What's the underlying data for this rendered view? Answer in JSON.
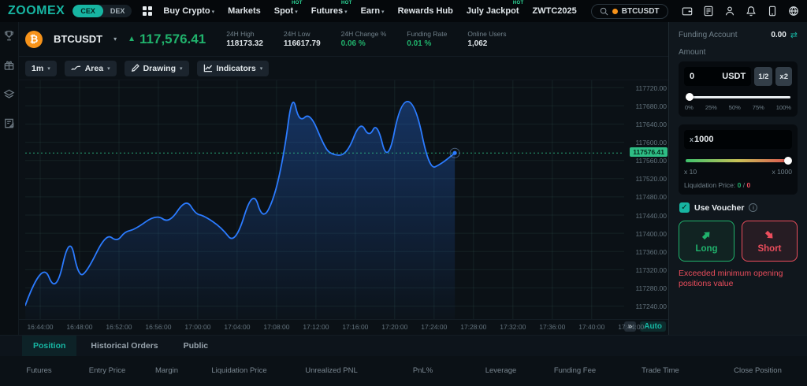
{
  "colors": {
    "accent": "#17b5a2",
    "green": "#20b26c",
    "red": "#eb4d5c",
    "blue": "#2b7bff",
    "orange": "#f7931a",
    "price_badge": "#2ebd85"
  },
  "nav": {
    "logo": "ZOOMEX",
    "cex": "CEX",
    "dex": "DEX",
    "hot_label": "HOT",
    "items": [
      {
        "label": "Buy Crypto"
      },
      {
        "label": "Markets"
      },
      {
        "label": "Spot"
      },
      {
        "label": "Futures"
      },
      {
        "label": "Earn"
      },
      {
        "label": "Rewards Hub"
      },
      {
        "label": "July Jackpot"
      },
      {
        "label": "ZWTC2025"
      }
    ],
    "search": {
      "value": "BTCUSDT"
    }
  },
  "ticker": {
    "symbol": "BTCUSDT",
    "up_arrow": "▲",
    "price": "117,576.41",
    "stats": [
      {
        "label": "24H High",
        "value": "118173.32"
      },
      {
        "label": "24H Low",
        "value": "116617.79"
      },
      {
        "label": "24H Change %",
        "value": "0.06 %"
      },
      {
        "label": "Funding Rate",
        "value": "0.01 %"
      },
      {
        "label": "Online Users",
        "value": "1,062"
      }
    ]
  },
  "toolbar": {
    "interval": "1m",
    "chart_type": "Area",
    "drawing": "Drawing",
    "indicators": "Indicators"
  },
  "chart_data": {
    "type": "area",
    "title": "BTCUSDT 1 minute area chart",
    "line_color": "#2b7bff",
    "grid": true,
    "xlim": [
      -1.52,
      59.3
    ],
    "ylim": [
      117211.6,
      117736
    ],
    "last_price": 117576.41,
    "y_ticks": [
      117240,
      117280,
      117320,
      117360,
      117400,
      117440,
      117480,
      117520,
      117560,
      117600,
      117640,
      117680,
      117720
    ],
    "x_ticks": [
      {
        "min": 0,
        "label": "16:44:00"
      },
      {
        "min": 4,
        "label": "16:48:00"
      },
      {
        "min": 8,
        "label": "16:52:00"
      },
      {
        "min": 12,
        "label": "16:56:00"
      },
      {
        "min": 16,
        "label": "17:00:00"
      },
      {
        "min": 20,
        "label": "17:04:00"
      },
      {
        "min": 24,
        "label": "17:08:00"
      },
      {
        "min": 28,
        "label": "17:12:00"
      },
      {
        "min": 32,
        "label": "17:16:00"
      },
      {
        "min": 36,
        "label": "17:20:00"
      },
      {
        "min": 40,
        "label": "17:24:00"
      },
      {
        "min": 44,
        "label": "17:28:00"
      },
      {
        "min": 48,
        "label": "17:32:00"
      },
      {
        "min": 52,
        "label": "17:36:00"
      },
      {
        "min": 56,
        "label": "17:40:00"
      },
      {
        "min": 60,
        "label": "17:44:00"
      }
    ],
    "series": [
      {
        "name": "BTCUSDT",
        "points": [
          [
            -1.5,
            117242
          ],
          [
            0.2,
            117343
          ],
          [
            1.6,
            117264
          ],
          [
            3.0,
            117400
          ],
          [
            3.9,
            117303
          ],
          [
            4.8,
            117317
          ],
          [
            6.7,
            117400
          ],
          [
            7.8,
            117381
          ],
          [
            8.6,
            117404
          ],
          [
            9.6,
            117408
          ],
          [
            11.8,
            117442
          ],
          [
            13.1,
            117421
          ],
          [
            14.8,
            117477
          ],
          [
            15.8,
            117442
          ],
          [
            16.6,
            117439
          ],
          [
            18.4,
            117413
          ],
          [
            19.8,
            117374
          ],
          [
            21.6,
            117500
          ],
          [
            22.6,
            117427
          ],
          [
            23.8,
            117479
          ],
          [
            24.8,
            117579
          ],
          [
            25.6,
            117710
          ],
          [
            26.3,
            117643
          ],
          [
            27.4,
            117666
          ],
          [
            28.8,
            117593
          ],
          [
            29.5,
            117573
          ],
          [
            31.1,
            117570
          ],
          [
            32.5,
            117648
          ],
          [
            33.4,
            117610
          ],
          [
            34.2,
            117645
          ],
          [
            35.3,
            117549
          ],
          [
            36.6,
            117692
          ],
          [
            38.1,
            117687
          ],
          [
            39.5,
            117540
          ],
          [
            40.7,
            117552
          ],
          [
            42.1,
            117576.41
          ]
        ]
      }
    ]
  },
  "timeline": {
    "fast_forward": "»",
    "auto": "Auto"
  },
  "panel": {
    "funding_account_label": "Funding Account",
    "funding_account_value": "0.00",
    "transfer_icon": "⇄",
    "amount_label": "Amount",
    "amount_value": "0",
    "currency": "USDT",
    "half_btn": "1/2",
    "x2_btn": "x2",
    "pct_ticks": [
      "0%",
      "25%",
      "50%",
      "75%",
      "100%"
    ],
    "leverage_prefix": "x",
    "leverage_value": "1000",
    "lev_min": "x 10",
    "lev_max": "x 1000",
    "liq_label": "Liquidation Price:",
    "liq_long": "0",
    "liq_sep": "/",
    "liq_short": "0",
    "voucher_check": "✓",
    "voucher_label": "Use Voucher",
    "info": "i",
    "long_label": "Long",
    "short_label": "Short",
    "error": "Exceeded minimum opening positions value"
  },
  "tabs": [
    {
      "label": "Position"
    },
    {
      "label": "Historical Orders"
    },
    {
      "label": "Public"
    }
  ],
  "table_headers": [
    "Futures",
    "Entry Price",
    "Margin",
    "Liquidation Price",
    "Unrealized PNL",
    "PnL%",
    "Leverage",
    "Funding Fee",
    "Trade Time",
    "Close Position"
  ]
}
